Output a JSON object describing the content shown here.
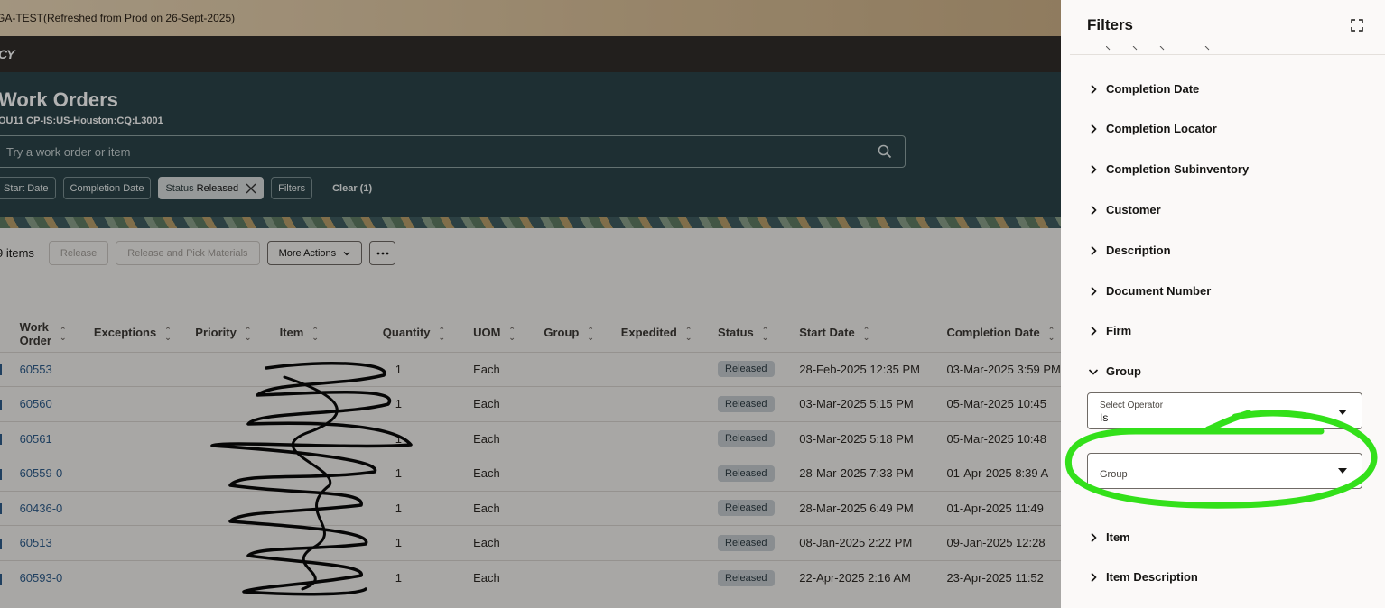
{
  "env_banner": "GA-TEST(Refreshed from Prod on 26-Sept-2025)",
  "brand": "CY",
  "header": {
    "title": "Work Orders",
    "subtitle": "OU11 CP-IS:US-Houston:CQ:L3001",
    "search_placeholder": "Try a work order or item"
  },
  "chips": {
    "start_date": "Start Date",
    "completion_date": "Completion Date",
    "status_label": "Status",
    "status_value": "Released",
    "filters": "Filters",
    "clear": "Clear (1)"
  },
  "toolbar": {
    "count": "9 items",
    "release": "Release",
    "release_pick": "Release and Pick Materials",
    "more_actions": "More Actions"
  },
  "table": {
    "columns": {
      "work_order_1": "Work",
      "work_order_2": "Order",
      "exceptions": "Exceptions",
      "priority": "Priority",
      "item": "Item",
      "quantity": "Quantity",
      "uom": "UOM",
      "group": "Group",
      "expedited": "Expedited",
      "status": "Status",
      "start_date": "Start Date",
      "completion_date": "Completion Date"
    },
    "rows": [
      {
        "wo": "60553",
        "qty": "1",
        "uom": "Each",
        "status": "Released",
        "start": "28-Feb-2025 12:35 PM",
        "completion": "03-Mar-2025 3:59 PM"
      },
      {
        "wo": "60560",
        "qty": "1",
        "uom": "Each",
        "status": "Released",
        "start": "03-Mar-2025 5:15 PM",
        "completion": "05-Mar-2025 10:45"
      },
      {
        "wo": "60561",
        "qty": "1",
        "uom": "Each",
        "status": "Released",
        "start": "03-Mar-2025 5:18 PM",
        "completion": "05-Mar-2025 10:48"
      },
      {
        "wo": "60559-0",
        "qty": "1",
        "uom": "Each",
        "status": "Released",
        "start": "28-Mar-2025 7:33 PM",
        "completion": "01-Apr-2025 8:39 A"
      },
      {
        "wo": "60436-0",
        "qty": "1",
        "uom": "Each",
        "status": "Released",
        "start": "28-Mar-2025 6:49 PM",
        "completion": "01-Apr-2025 11:49"
      },
      {
        "wo": "60513",
        "qty": "1",
        "uom": "Each",
        "status": "Released",
        "start": "08-Jan-2025 2:22 PM",
        "completion": "09-Jan-2025 12:28"
      },
      {
        "wo": "60593-0",
        "qty": "1",
        "uom": "Each",
        "status": "Released",
        "start": "22-Apr-2025 2:16 AM",
        "completion": "23-Apr-2025 11:52"
      }
    ]
  },
  "filters": {
    "title": "Filters",
    "items": {
      "completion_date": "Completion Date",
      "completion_locator": "Completion Locator",
      "completion_subinventory": "Completion Subinventory",
      "customer": "Customer",
      "description": "Description",
      "document_number": "Document Number",
      "firm": "Firm",
      "group": "Group",
      "item": "Item",
      "item_description": "Item Description"
    },
    "operator_label": "Select Operator",
    "operator_value": "Is",
    "group_placeholder": "Group"
  },
  "colors": {
    "hero": "#2c4449",
    "brand_bar": "#312d2a",
    "link": "#2e5c8a",
    "highlight": "#33e01a"
  }
}
